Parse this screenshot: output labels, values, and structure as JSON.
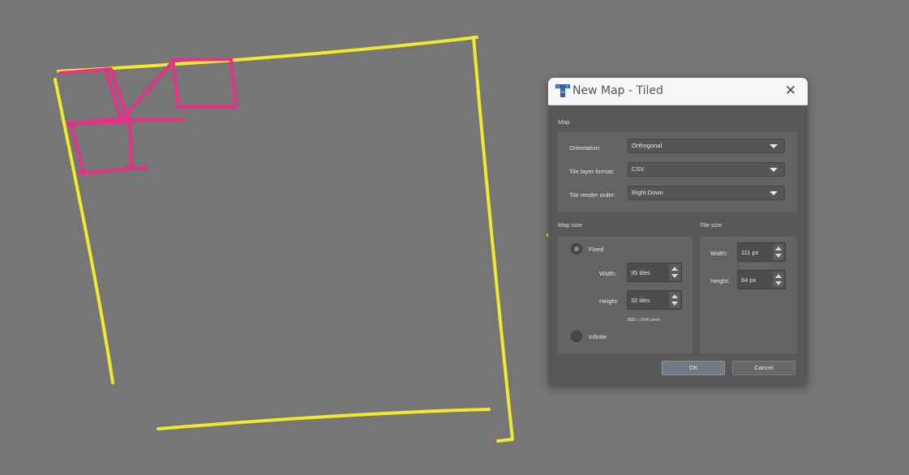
{
  "dialog": {
    "title": "New Map - Tiled",
    "close_glyph": "✕",
    "app_icon": "tiled-t-icon"
  },
  "map_section": {
    "label": "Map",
    "orientation": {
      "label": "Orientation:",
      "value": "Orthogonal"
    },
    "tile_layer_format": {
      "label": "Tile layer format:",
      "value": "CSV"
    },
    "tile_render_order": {
      "label": "Tile render order:",
      "value": "Right Down"
    }
  },
  "map_size": {
    "label": "Map size",
    "fixed_label": "Fixed",
    "fixed_selected": true,
    "width": {
      "label": "Width:",
      "value": "35 tiles"
    },
    "height": {
      "label": "Height:",
      "value": "32 tiles"
    },
    "pixels": "3885 x 2048 pixels",
    "infinite_label": "Infinite"
  },
  "tile_size": {
    "label": "Tile size",
    "width": {
      "label": "Width:",
      "value": "111 px"
    },
    "height": {
      "label": "Height:",
      "value": "64 px"
    }
  },
  "buttons": {
    "ok": "OK",
    "cancel": "Cancel"
  },
  "colors": {
    "background": "#767676",
    "dialog_body": "#585858",
    "yellow_annotation": "#f0ea2c",
    "pink_annotation": "#ea2f88"
  }
}
